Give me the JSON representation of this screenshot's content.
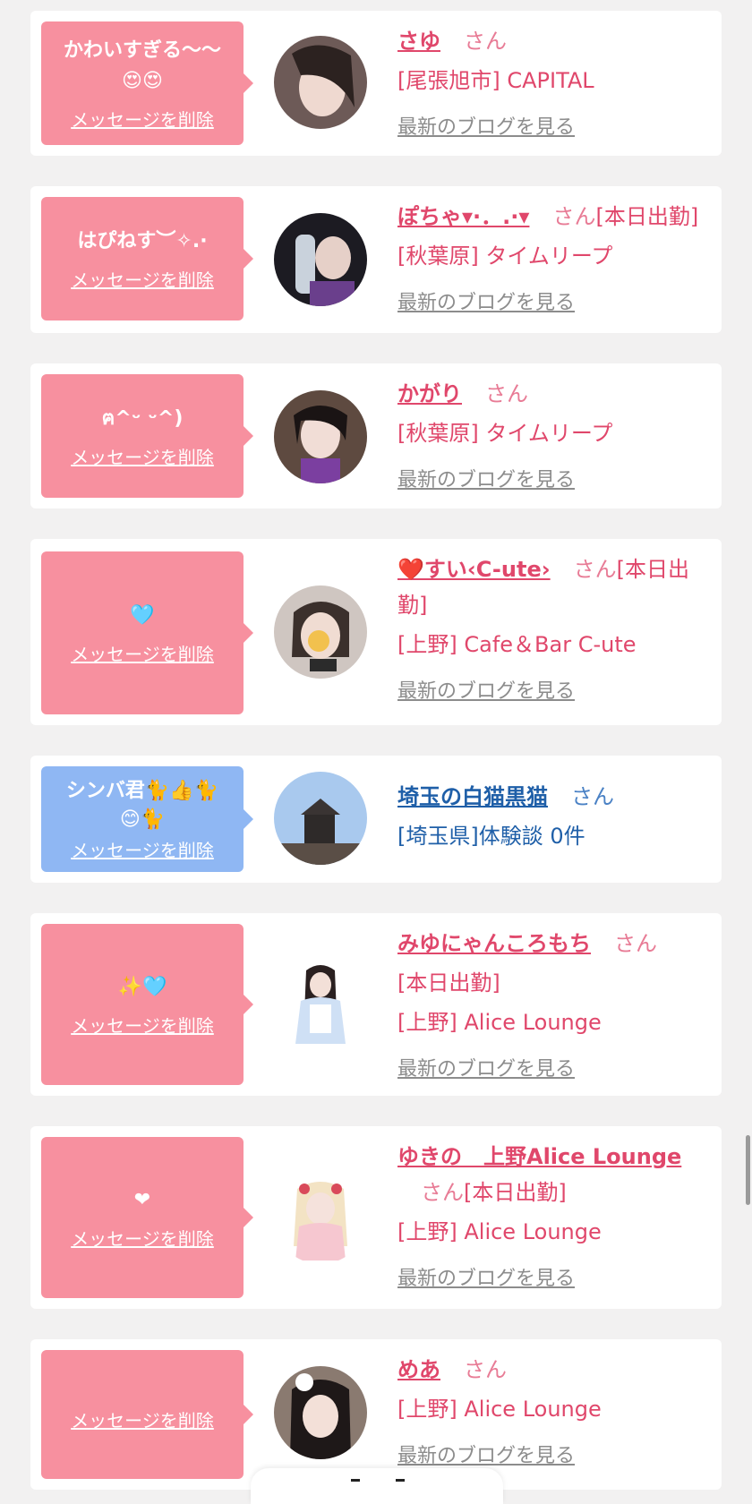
{
  "delete_label": "メッセージを削除",
  "blog_label": "最新のブログを見る",
  "honorific": "さん",
  "entries": [
    {
      "message": "かわいすぎる〜〜\n😍😍",
      "name": "さゆ",
      "status": "",
      "shop": "[尾張旭市] CAPITAL"
    },
    {
      "message": "はぴねす︶✧.·",
      "name": "ぽちゃ▾·．.·▾",
      "status": "[本日出勤]",
      "shop": "[秋葉原] タイムリープ"
    },
    {
      "message": "ฅ^ᵕ ᵕ^)",
      "name": "かがり",
      "status": "",
      "shop": "[秋葉原] タイムリープ"
    },
    {
      "message": "🩵",
      "name": "❤️すい‹C-ute›",
      "status": "[本日出勤]",
      "shop": "[上野] Cafe＆Bar C-ute"
    },
    {
      "message": "シンバ君🐈👍🐈\n😊🐈",
      "name": "埼玉の白猫黒猫",
      "status": "",
      "shop": "[埼玉県]体験談 0件"
    },
    {
      "message": "✨🩵",
      "name": "みゆにゃんころもち",
      "status": "[本日出勤]",
      "shop": "[上野] Alice Lounge"
    },
    {
      "message": "❤",
      "name": "ゆきの　上野Alice Lounge",
      "status": "[本日出勤]",
      "shop": "[上野] Alice Lounge"
    },
    {
      "message": "",
      "name": "めあ",
      "status": "",
      "shop": "[上野] Alice Lounge"
    }
  ],
  "colors": {
    "pink": "#f7909f",
    "blue_bubble": "#8fb7f3",
    "pink_text": "#e0476b",
    "blue_text": "#1f5fa8"
  }
}
